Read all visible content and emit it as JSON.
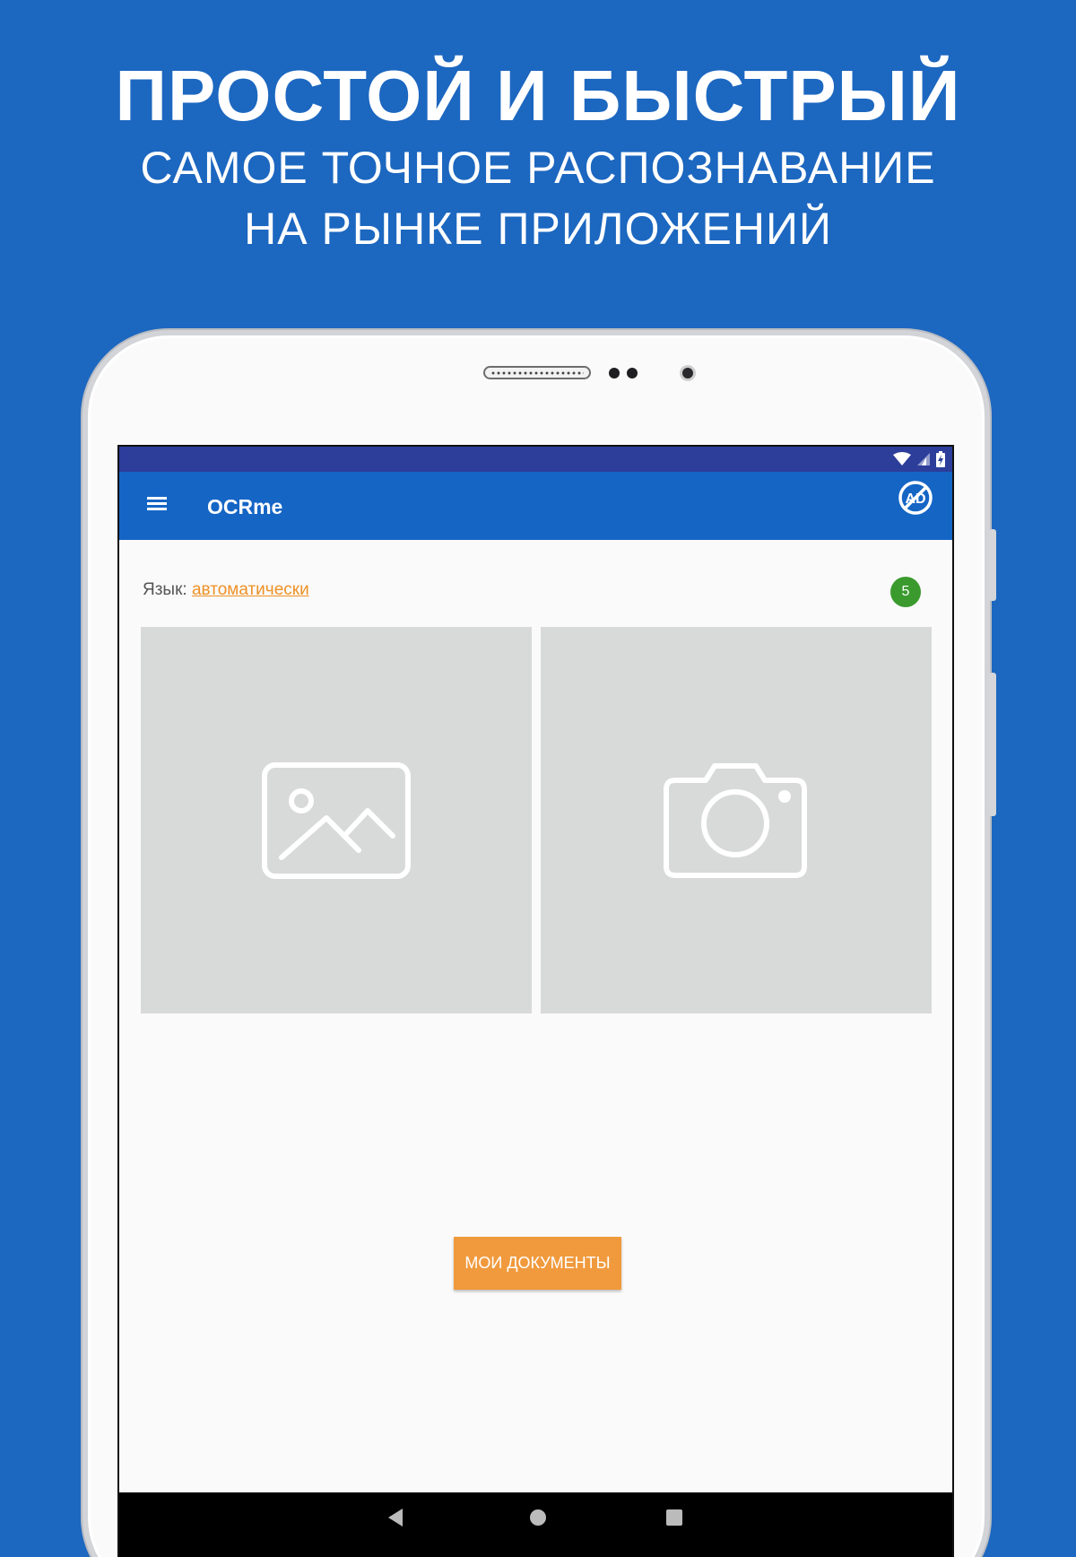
{
  "promo": {
    "title": "ПРОСТОЙ И БЫСТРЫЙ",
    "subtitle_line1": "САМОЕ ТОЧНОЕ РАСПОЗНАВАНИЕ",
    "subtitle_line2": "НА РЫНКЕ ПРИЛОЖЕНИЙ"
  },
  "colors": {
    "background": "#1c67c0",
    "status_bar": "#2c3d9a",
    "app_bar": "#1565c5",
    "accent_orange": "#f09a3d",
    "badge_green": "#3b9a2e",
    "tile_gray": "#d8d9d9"
  },
  "appbar": {
    "title": "OCRme",
    "menu_icon": "hamburger-menu-icon",
    "noads_icon": "no-ads-icon",
    "noads_text": "AD"
  },
  "language": {
    "label": "Язык:",
    "value": "автоматически"
  },
  "badge": {
    "count": "5"
  },
  "tiles": [
    {
      "icon": "gallery-image-icon"
    },
    {
      "icon": "camera-icon"
    }
  ],
  "docs_button": {
    "label": "МОИ ДОКУМЕНТЫ"
  },
  "navbar": {
    "back_icon": "back-triangle-icon",
    "home_icon": "home-circle-icon",
    "recent_icon": "recent-apps-square-icon"
  }
}
